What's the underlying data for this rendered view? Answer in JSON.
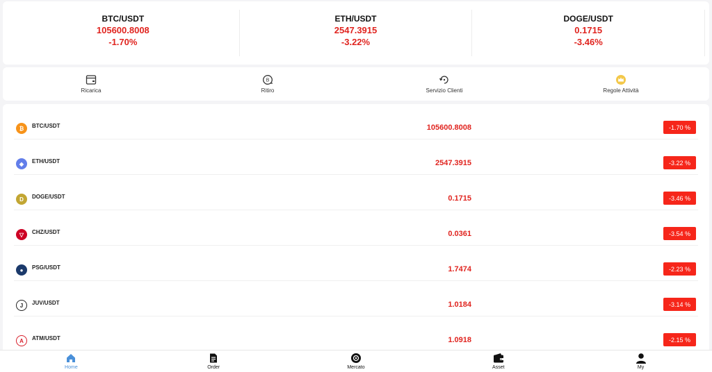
{
  "tickers": [
    {
      "pair": "BTC/USDT",
      "price": "105600.8008",
      "change": "-1.70%"
    },
    {
      "pair": "ETH/USDT",
      "price": "2547.3915",
      "change": "-3.22%"
    },
    {
      "pair": "DOGE/USDT",
      "price": "0.1715",
      "change": "-3.46%"
    }
  ],
  "actions": [
    {
      "label": "Ricarica",
      "icon": "wallet-card-icon"
    },
    {
      "label": "Ritiro",
      "icon": "withdraw-coin-icon"
    },
    {
      "label": "Servizio Clienti",
      "icon": "headset-refresh-icon"
    },
    {
      "label": "Regole Attività",
      "icon": "crown-icon"
    }
  ],
  "market": [
    {
      "symbol": "BTC/USDT",
      "price": "105600.8008",
      "change": "-1.70 %",
      "icon": "btc-icon",
      "color": "#f7931a",
      "glyph": "₿"
    },
    {
      "symbol": "ETH/USDT",
      "price": "2547.3915",
      "change": "-3.22 %",
      "icon": "eth-icon",
      "color": "#627eea",
      "glyph": "◆"
    },
    {
      "symbol": "DOGE/USDT",
      "price": "0.1715",
      "change": "-3.46 %",
      "icon": "doge-icon",
      "color": "#c2a633",
      "glyph": "D"
    },
    {
      "symbol": "CHZ/USDT",
      "price": "0.0361",
      "change": "-3.54 %",
      "icon": "chz-icon",
      "color": "#cd0124",
      "glyph": "▽"
    },
    {
      "symbol": "PSG/USDT",
      "price": "1.7474",
      "change": "-2.23 %",
      "icon": "psg-icon",
      "color": "#1b3a6b",
      "glyph": "●"
    },
    {
      "symbol": "JUV/USDT",
      "price": "1.0184",
      "change": "-3.14 %",
      "icon": "juv-icon",
      "color": "#ffffff",
      "glyph": "J"
    },
    {
      "symbol": "ATM/USDT",
      "price": "1.0918",
      "change": "-2.15 %",
      "icon": "atm-icon",
      "color": "#d81f2b",
      "glyph": "A"
    }
  ],
  "nav": [
    {
      "label": "Home",
      "icon": "home-icon",
      "active": true
    },
    {
      "label": "Order",
      "icon": "document-icon",
      "active": false
    },
    {
      "label": "Mercato",
      "icon": "market-icon",
      "active": false
    },
    {
      "label": "Asset",
      "icon": "wallet-icon",
      "active": false
    },
    {
      "label": "My",
      "icon": "user-icon",
      "active": false
    }
  ],
  "colors": {
    "negative": "#e0241f",
    "badge": "#f6261a",
    "nav_active": "#4a90d9"
  }
}
